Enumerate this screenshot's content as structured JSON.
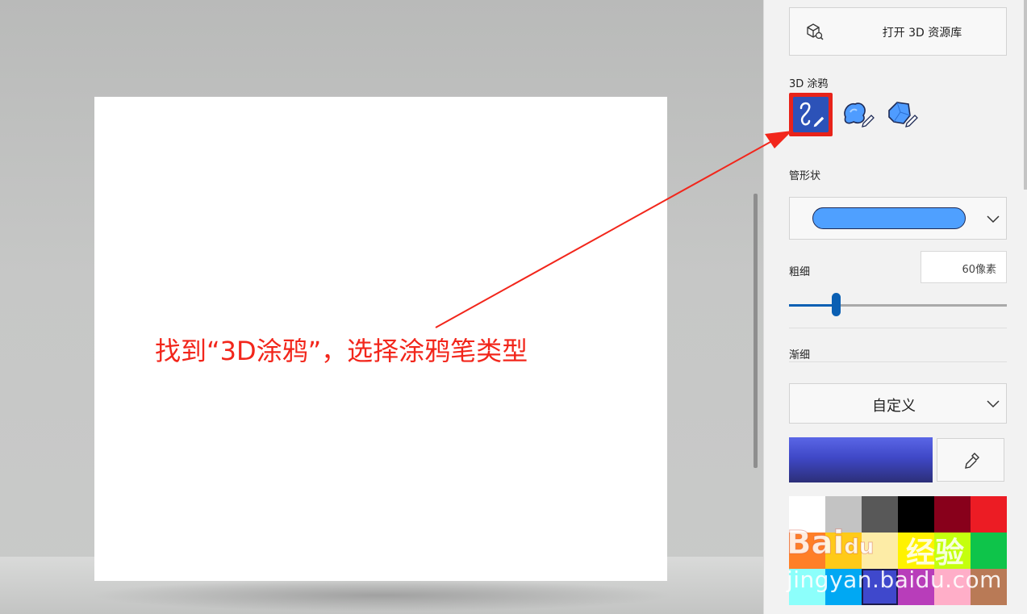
{
  "panel": {
    "open_library_label": "打开 3D 资源库",
    "doodle_section_label": "3D 涂鸦",
    "doodle_tools": [
      {
        "name": "tube-doodle",
        "selected": true
      },
      {
        "name": "soft-edge-doodle",
        "selected": false
      },
      {
        "name": "sharp-edge-doodle",
        "selected": false
      }
    ],
    "tube_shape_label": "管形状",
    "thickness_label": "粗细",
    "thickness_value": "60像素",
    "thickness_slider_fraction": 0.22,
    "taper_label": "渐细",
    "taper_select_value": "自定义",
    "current_color": "#4a54d6",
    "palette": [
      "#ffffff",
      "#c3c3c3",
      "#585858",
      "#000000",
      "#88001b",
      "#ec1c24",
      "#ff7f27",
      "#ffca18",
      "#fdeca6",
      "#fff200",
      "#c4ff0e",
      "#0ec44a",
      "#8cfffb",
      "#00a8f3",
      "#3f48cc",
      "#b83dba",
      "#ffaec8",
      "#b97a56"
    ],
    "selected_palette_index": 14
  },
  "annotation": {
    "text": "找到“3D涂鸦”，选择涂鸦笔类型",
    "color": "#f2261b"
  },
  "watermark": {
    "brand_a": "Bai",
    "brand_b": "du",
    "brand_c": "经验",
    "url": "jingyan.baidu.com"
  }
}
